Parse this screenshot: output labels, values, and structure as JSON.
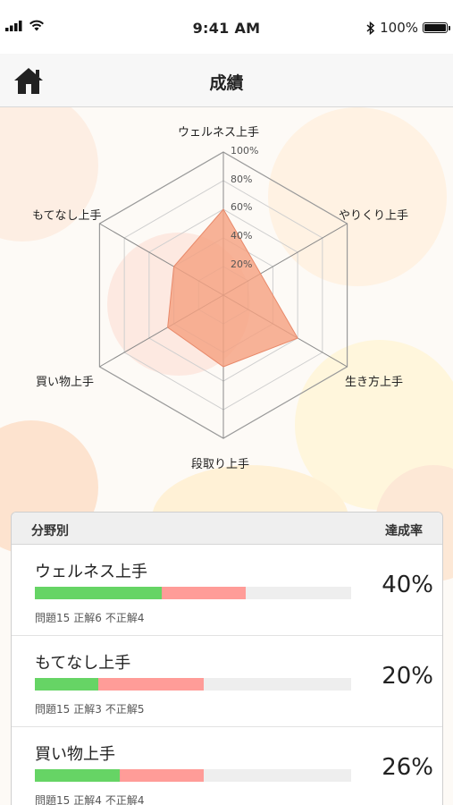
{
  "status_bar": {
    "time": "9:41 AM",
    "battery_text": "100%",
    "signal_icon": "signal-bars-icon",
    "wifi_icon": "wifi-icon",
    "bluetooth_icon": "bluetooth-icon",
    "battery_icon": "battery-icon"
  },
  "nav": {
    "title": "成績",
    "home_icon": "home-icon"
  },
  "radar": {
    "axes": [
      "ウェルネス上手",
      "やりくり上手",
      "生き方上手",
      "段取り上手",
      "買い物上手",
      "もてなし上手"
    ],
    "ticks": [
      "20%",
      "40%",
      "60%",
      "80%",
      "100%"
    ],
    "fill_color": "#f5a07f",
    "values": [
      0.6,
      0.3,
      0.6,
      0.5,
      0.45,
      0.4
    ]
  },
  "panel": {
    "header_left": "分野別",
    "header_right": "達成率",
    "rows": [
      {
        "name": "ウェルネス上手",
        "rate": "40%",
        "questions": "問題15",
        "correct": "正解6",
        "incorrect": "不正解4",
        "correct_fraction": 0.4,
        "incorrect_fraction": 0.267
      },
      {
        "name": "もてなし上手",
        "rate": "20%",
        "questions": "問題15",
        "correct": "正解3",
        "incorrect": "不正解5",
        "correct_fraction": 0.2,
        "incorrect_fraction": 0.333
      },
      {
        "name": "買い物上手",
        "rate": "26%",
        "questions": "問題15",
        "correct": "正解4",
        "incorrect": "不正解4",
        "correct_fraction": 0.267,
        "incorrect_fraction": 0.267
      }
    ]
  },
  "colors": {
    "correct_bar": "#66d465",
    "incorrect_bar": "#ff9c98",
    "track": "#eeeeee"
  }
}
